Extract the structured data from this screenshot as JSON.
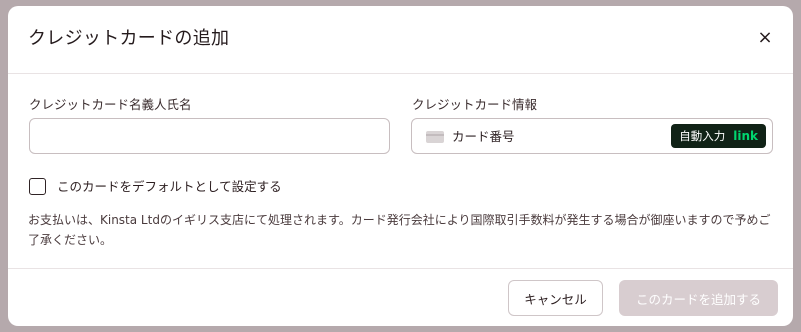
{
  "dialog": {
    "title": "クレジットカードの追加",
    "close_label": "×"
  },
  "form": {
    "name_label": "クレジットカード名義人氏名",
    "name_value": "",
    "card_label": "クレジットカード情報",
    "card_placeholder": "カード番号",
    "link_autofill": "自動入力",
    "link_brand": "link",
    "default_checkbox_label": "このカードをデフォルトとして設定する",
    "default_checked": false
  },
  "notice": "お支払いは、Kinsta Ltdのイギリス支店にて処理されます。カード発行会社により国際取引手数料が発生する場合が御座いますので予めご了承ください。",
  "footer": {
    "cancel_label": "キャンセル",
    "submit_label": "このカードを追加する",
    "submit_disabled": true
  },
  "colors": {
    "submit_disabled_bg": "#d8cdd0",
    "link_badge_bg": "#102216",
    "link_brand": "#00d66f"
  },
  "icons": {
    "card": "credit-card-icon",
    "close": "close-icon"
  }
}
